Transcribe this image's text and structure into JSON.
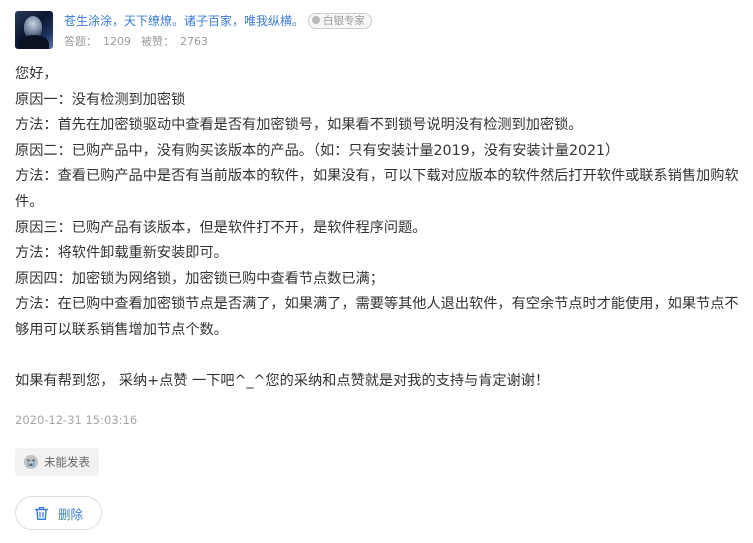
{
  "author": {
    "name": "苍生涂涂，天下缭燎。诸子百家，唯我纵横。",
    "level": "白银专家",
    "answers_label": "答题：",
    "answers": "1209",
    "likes_label": "被赞：",
    "likes": "2763"
  },
  "answer": {
    "lines": [
      "您好，",
      "原因一：没有检测到加密锁",
      "方法：首先在加密锁驱动中查看是否有加密锁号，如果看不到锁号说明没有检测到加密锁。",
      "原因二：已购产品中，没有购买该版本的产品。（如：只有安装计量2019，没有安装计量2021）",
      "方法：查看已购产品中是否有当前版本的软件，如果没有，可以下载对应版本的软件然后打开软件或联系销售加购软件。",
      "原因三：已购产品有该版本，但是软件打不开，是软件程序问题。",
      "方法：将软件卸载重新安装即可。",
      "原因四：加密锁为网络锁，加密锁已购中查看节点数已满；",
      "方法：在已购中查看加密锁节点是否满了，如果满了，需要等其他人退出软件，有空余节点时才能使用，如果节点不够用可以联系销售增加节点个数。"
    ],
    "closing": "如果有帮到您， 采纳+点赞 一下吧^_^您的采纳和点赞就是对我的支持与肯定谢谢！"
  },
  "timestamp": "2020-12-31 15:03:16",
  "status_badge": {
    "label": "未能发表",
    "icon": "crying-face-icon"
  },
  "delete_button": {
    "label": "删除",
    "icon": "trash-icon"
  },
  "colors": {
    "link_blue": "#3a7bd5",
    "meta_gray": "#a6a6a6",
    "text": "#333333"
  }
}
